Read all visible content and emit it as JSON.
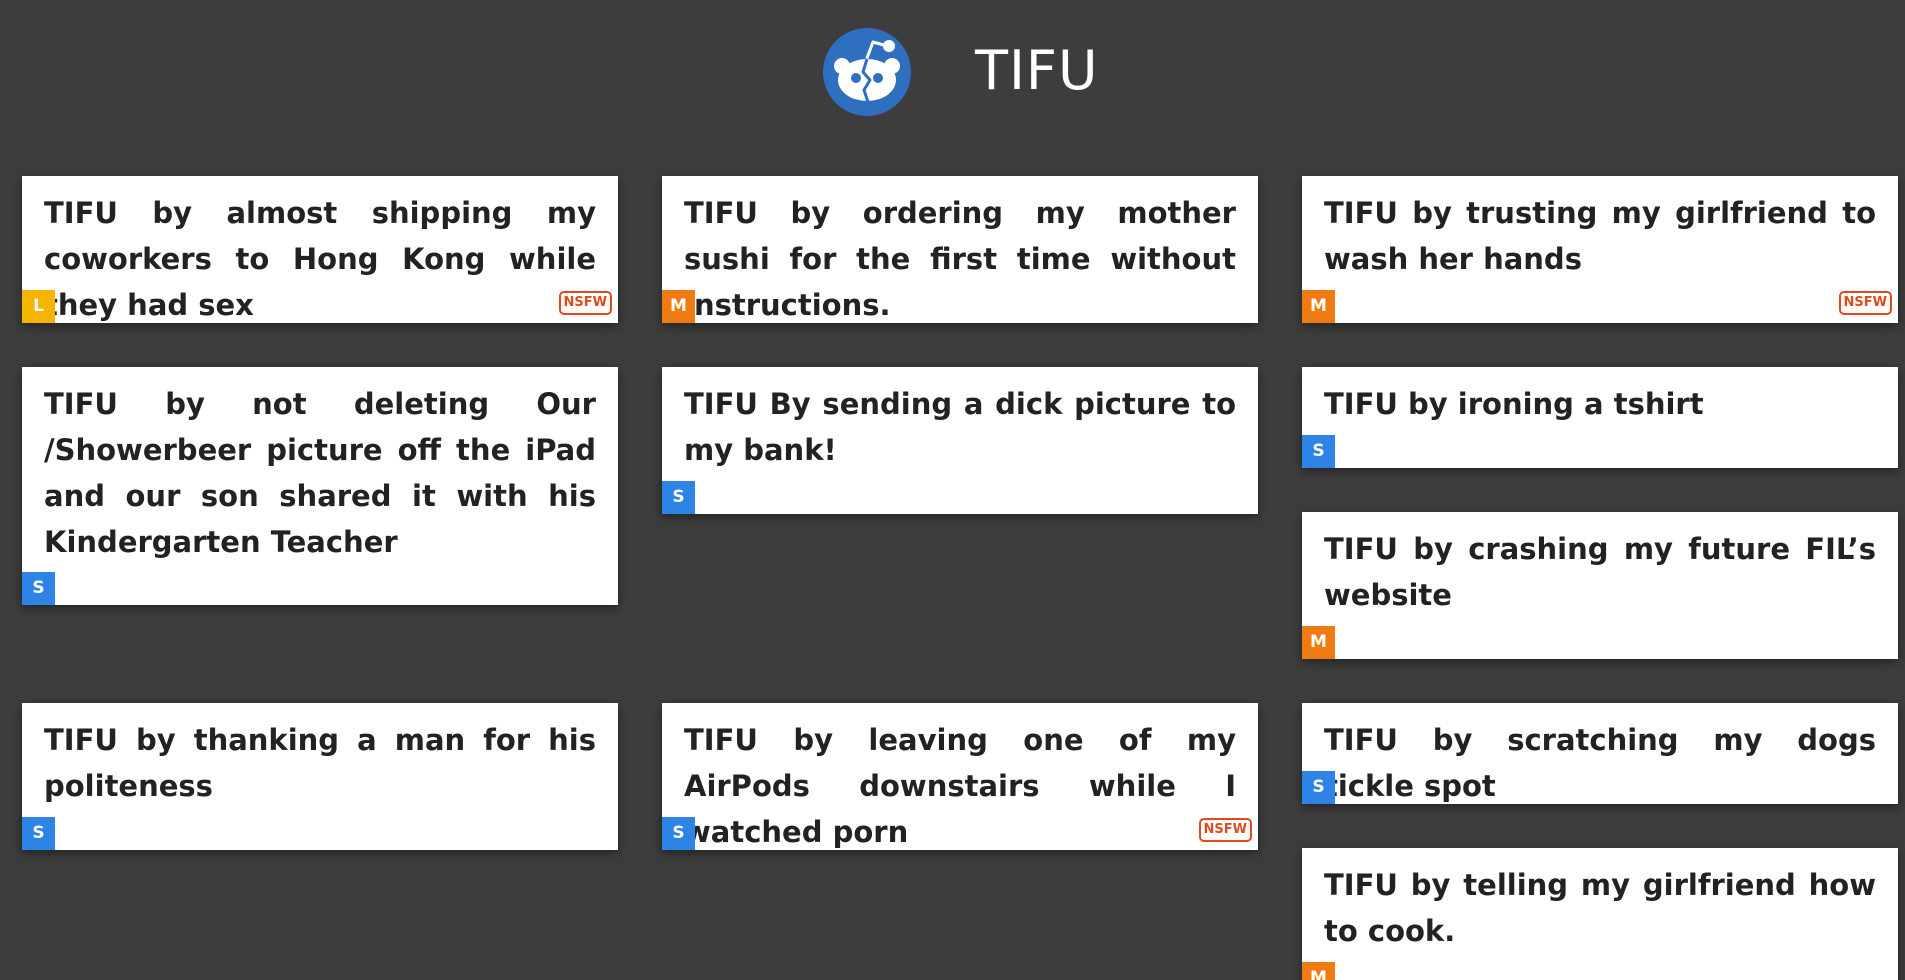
{
  "site": {
    "title": "TIFU",
    "logo_icon": "reddit-alien-icon",
    "logo_color": "#2f6fc0"
  },
  "colors": {
    "background": "#3d3d3d",
    "card": "#ffffff",
    "badge_L": "#f5b400",
    "badge_M": "#f07b12",
    "badge_S": "#2d84e6",
    "nsfw": "#e04a1f"
  },
  "posts": [
    {
      "title": "TIFU by almost shipping my coworkers to Hong Kong while they had sex",
      "size": "L",
      "nsfw": "NSFW"
    },
    {
      "title": "TIFU by ordering my mother sushi for the first time without instructions.",
      "size": "M",
      "nsfw": ""
    },
    {
      "title": "TIFU by trusting my girlfriend to wash her hands",
      "size": "M",
      "nsfw": "NSFW"
    },
    {
      "title": "TIFU by not deleting Our /Showerbeer picture off the iPad and our son shared it with his Kindergarten Teacher",
      "size": "S",
      "nsfw": ""
    },
    {
      "title": "TIFU By sending a dick picture to my bank!",
      "size": "S",
      "nsfw": ""
    },
    {
      "title": "TIFU by ironing a tshirt",
      "size": "S",
      "nsfw": ""
    },
    {
      "title": "TIFU by crashing my future FIL’s website",
      "size": "M",
      "nsfw": ""
    },
    {
      "title": "TIFU by thanking a man for his politeness",
      "size": "S",
      "nsfw": ""
    },
    {
      "title": "TIFU by leaving one of my AirPods downstairs while I watched porn",
      "size": "S",
      "nsfw": "NSFW"
    },
    {
      "title": "TIFU by scratching my dogs tickle spot",
      "size": "S",
      "nsfw": ""
    },
    {
      "title": "TIFU by telling my girlfriend how to cook.",
      "size": "M",
      "nsfw": ""
    }
  ]
}
